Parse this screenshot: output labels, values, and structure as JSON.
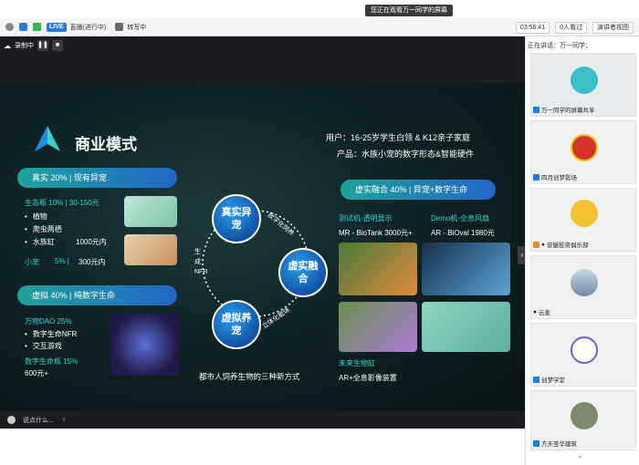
{
  "notice": "您正在观看万一同学的屏幕",
  "toolbar": {
    "live_badge": "LIVE",
    "live_status": "直播(进行中)",
    "transcribe": "转写中",
    "timer": "03:56:41",
    "attendees": "0人看过",
    "view_mode": "演讲者视图"
  },
  "recording": {
    "label": "录制中"
  },
  "slide": {
    "title": "商业模式",
    "users": "用户：16-25岁学生白领 & K12亲子家庭",
    "product": "产品：水族小宠的数字形态&智能硬件",
    "pill_real": "真实 20% | 现有异宠",
    "eco_bottle": "生态瓶 10% | 30-150元",
    "eco_items": [
      "植物",
      "爬虫两栖",
      "水族缸"
    ],
    "eco_price": "1000元内",
    "small_pet": "小宠",
    "small_pet_pct": "5% |",
    "small_pet_price": "300元内",
    "pill_virtual": "虚拟 40% | 纯数字生命",
    "dao": "万物DAO 25%",
    "dao_items": [
      "数字生命NFR",
      "交互游戏"
    ],
    "digital_bottle": "数字生命瓶 15%",
    "digital_bottle_price": "600元+",
    "circle_real": "真实异宠",
    "circle_mix": "虚实融合",
    "circle_virtual": "虚拟养宠",
    "arc_top": "数字化饲养",
    "arc_bottom": "立体化载体",
    "arc_left": "生成NFR",
    "caption": "都市人饲养生物的三种新方式",
    "pill_mix": "虚实融合 40% | 异宠+数字生命",
    "test_machine": "测试机-透明显示",
    "demo_machine": "Demo机-全息风扇",
    "mr_product": "MR - BioTank 3000元+",
    "ar_product": "AR - BiOval 1980元",
    "future_tank": "未来生物缸",
    "future_desc": "AR+全息影像装置"
  },
  "chat": {
    "placeholder": "说点什么..."
  },
  "sidebar": {
    "speaking": "正在讲话：万一同学；",
    "tiles": [
      {
        "label": "万一同学的屏幕共享"
      },
      {
        "label": "四月创梦影场"
      },
      {
        "label": "安徽投资俱乐部"
      },
      {
        "label": "云麦"
      },
      {
        "label": "创梦学堂"
      },
      {
        "label": "方天圣华建筑"
      }
    ]
  },
  "colors": {
    "accent_cyan": "#37d6c8",
    "accent_yellow": "#f5d547",
    "live_blue": "#2a7ae2"
  }
}
